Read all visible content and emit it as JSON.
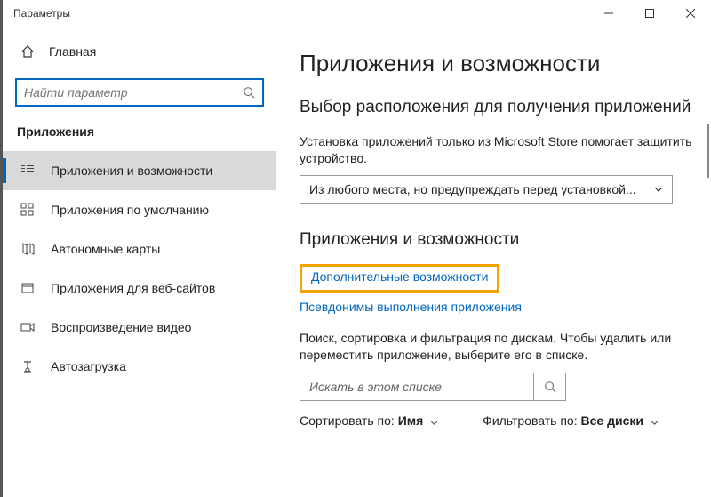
{
  "window": {
    "title": "Параметры"
  },
  "sidebar": {
    "home": "Главная",
    "search_placeholder": "Найти параметр",
    "section": "Приложения",
    "items": [
      {
        "label": "Приложения и возможности"
      },
      {
        "label": "Приложения по умолчанию"
      },
      {
        "label": "Автономные карты"
      },
      {
        "label": "Приложения для веб-сайтов"
      },
      {
        "label": "Воспроизведение видео"
      },
      {
        "label": "Автозагрузка"
      }
    ]
  },
  "main": {
    "title": "Приложения и возможности",
    "source_heading": "Выбор расположения для получения приложений",
    "source_desc": "Установка приложений только из Microsoft Store помогает защитить устройство.",
    "source_dropdown": "Из любого места, но предупреждать перед установкой...",
    "apps_heading": "Приложения и возможности",
    "link_optional": "Дополнительные возможности",
    "link_aliases": "Псевдонимы выполнения приложения",
    "filter_desc": "Поиск, сортировка и фильтрация по дискам. Чтобы удалить или переместить приложение, выберите его в списке.",
    "list_search_placeholder": "Искать в этом списке",
    "sort_label": "Сортировать по:",
    "sort_value": "Имя",
    "filter_label": "Фильтровать по:",
    "filter_value": "Все диски"
  }
}
